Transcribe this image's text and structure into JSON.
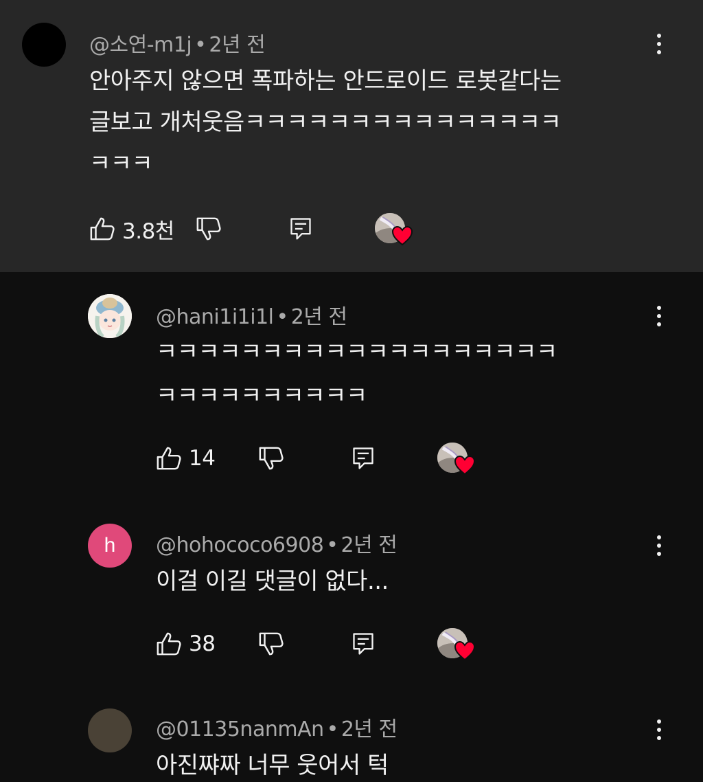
{
  "colors": {
    "background": "#0f0f0f",
    "highlight": "#272727",
    "meta_text": "#aaaaaa",
    "heart": "#ff0033",
    "avatar_pink": "#e0497a"
  },
  "comments": [
    {
      "handle": "@소연-m1j",
      "dot": "•",
      "time": "2년 전",
      "lines": [
        "안아주지 않으면 폭파하는 안드로이드 로봇같다는",
        "글보고 개처웃음ㅋㅋㅋㅋㅋㅋㅋㅋㅋㅋㅋㅋㅋㅋㅋ",
        "ㅋㅋㅋ"
      ],
      "likes": "3.8천",
      "icons": [
        "thumbs-up-icon",
        "thumbs-down-icon",
        "reply-icon",
        "creator-heart-icon",
        "more-vertical-icon"
      ]
    },
    {
      "handle": "@hani1i1i1l",
      "dot": "•",
      "time": "2년 전",
      "lines": [
        "ㅋㅋㅋㅋㅋㅋㅋㅋㅋㅋㅋㅋㅋㅋㅋㅋㅋㅋㅋ",
        "ㅋㅋㅋㅋㅋㅋㅋㅋㅋㅋ"
      ],
      "likes": "14"
    },
    {
      "handle": "@hohococo6908",
      "dot": "•",
      "time": "2년 전",
      "avatar_letter": "h",
      "lines": [
        "이걸 이길 댓글이 없다..."
      ],
      "likes": "38"
    },
    {
      "handle": "@01135nanmAn",
      "dot": "•",
      "time": "2년 전",
      "lines": [
        "아진쨔짜 너무 웃어서 턱"
      ]
    }
  ]
}
